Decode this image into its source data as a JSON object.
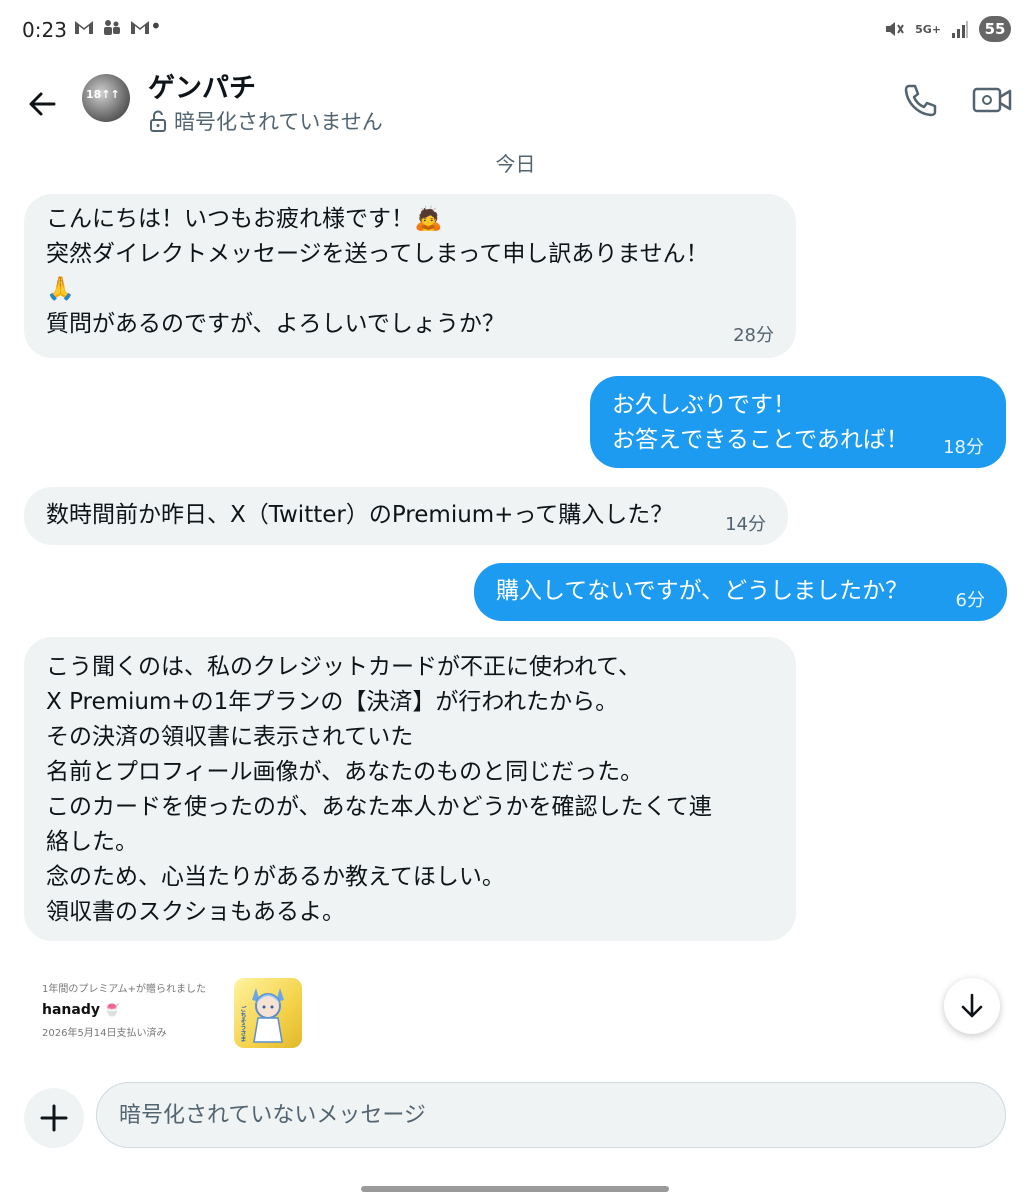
{
  "status_bar": {
    "time": "0:23",
    "left_icons": [
      "gmail-icon",
      "teams-icon",
      "gmail-icon"
    ],
    "network": "5G+",
    "battery": "55"
  },
  "header": {
    "contact_name": "ゲンパチ",
    "encryption_status": "暗号化されていません",
    "avatar_text": "18↑↑"
  },
  "date_separator": "今日",
  "messages": [
    {
      "direction": "incoming",
      "lines": [
        "こんにちは！いつもお疲れ様です！🙇",
        "突然ダイレクトメッセージを送ってしまって申し訳ありません！",
        "🙏",
        "質問があるのですが、よろしいでしょうか？"
      ],
      "time": "28分"
    },
    {
      "direction": "outgoing",
      "lines": [
        "お久しぶりです！",
        "お答えできることであれば！"
      ],
      "time": "18分"
    },
    {
      "direction": "incoming",
      "lines": [
        "数時間前か昨日、X（Twitter）のPremium+って購入した？"
      ],
      "time": "14分"
    },
    {
      "direction": "outgoing",
      "lines": [
        "購入してないですが、どうしましたか？"
      ],
      "time": "6分"
    },
    {
      "direction": "incoming",
      "lines": [
        "こう聞くのは、私のクレジットカードが不正に使われて、",
        "X Premium+の1年プランの【決済】が行われたから。",
        "その決済の領収書に表示されていた",
        "名前とプロフィール画像が、あなたのものと同じだった。",
        "このカードを使ったのが、あなた本人かどうかを確認したくて連",
        "絡した。",
        "念のため、心当たりがあるか教えてほしい。",
        "領収書のスクショもあるよ。"
      ],
      "time": ""
    }
  ],
  "receipt": {
    "caption": "1年間のプレミアム+が贈られました",
    "name": "hanady",
    "emoji": "🍧",
    "date": "2026年5月14日支払い済み",
    "thumb_text": "ごちそうさま"
  },
  "composer": {
    "placeholder": "暗号化されていないメッセージ"
  },
  "colors": {
    "outgoing_bubble": "#1d9bf0",
    "incoming_bubble": "#eff3f4",
    "secondary_text": "#536471"
  }
}
